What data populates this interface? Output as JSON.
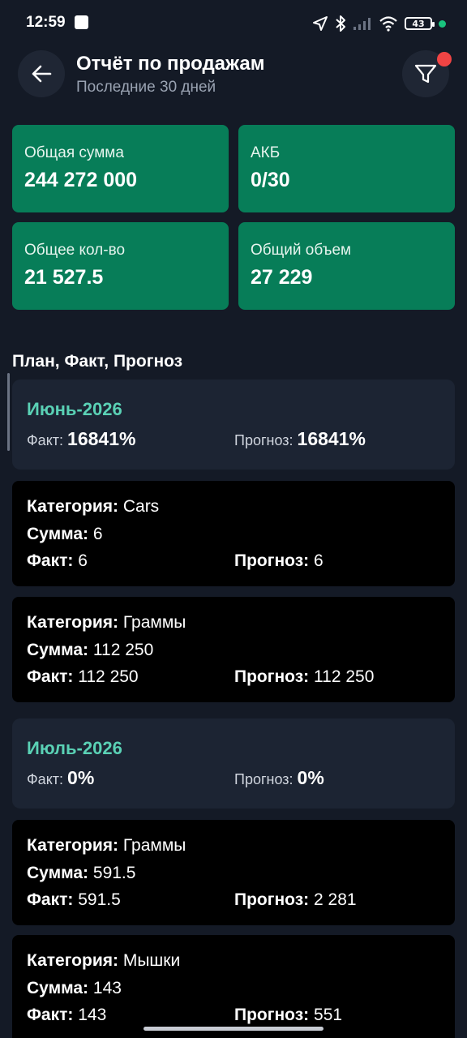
{
  "status_bar": {
    "time": "12:59",
    "battery": "43"
  },
  "header": {
    "title": "Отчёт по продажам",
    "subtitle": "Последние 30 дней"
  },
  "stats": [
    {
      "label": "Общая сумма",
      "value": "244 272 000"
    },
    {
      "label": "АКБ",
      "value": "0/30"
    },
    {
      "label": "Общее кол-во",
      "value": "21 527.5"
    },
    {
      "label": "Общий объем",
      "value": "27 229"
    }
  ],
  "section": {
    "title": "План, Факт, Прогноз"
  },
  "labels": {
    "fact": "Факт:",
    "forecast": "Прогноз:",
    "category": "Категория:",
    "sum": "Сумма:"
  },
  "months": [
    {
      "name": "Июнь-2026",
      "fact": "16841%",
      "forecast": "16841%",
      "categories": [
        {
          "category": "Cars",
          "sum": "6",
          "fact": "6",
          "forecast": "6"
        },
        {
          "category": "Граммы",
          "sum": "112 250",
          "fact": "112 250",
          "forecast": "112 250"
        }
      ]
    },
    {
      "name": "Июль-2026",
      "fact": "0%",
      "forecast": "0%",
      "categories": [
        {
          "category": "Граммы",
          "sum": "591.5",
          "fact": "591.5",
          "forecast": "2 281"
        },
        {
          "category": "Мышки",
          "sum": "143",
          "fact": "143",
          "forecast": "551"
        }
      ]
    }
  ],
  "colors": {
    "background": "#141a26",
    "stat_card": "#077d58",
    "month_accent": "#5ad1b5",
    "badge": "#f04444"
  },
  "icons": {
    "back": "arrow-left-icon",
    "filter": "filter-icon"
  }
}
